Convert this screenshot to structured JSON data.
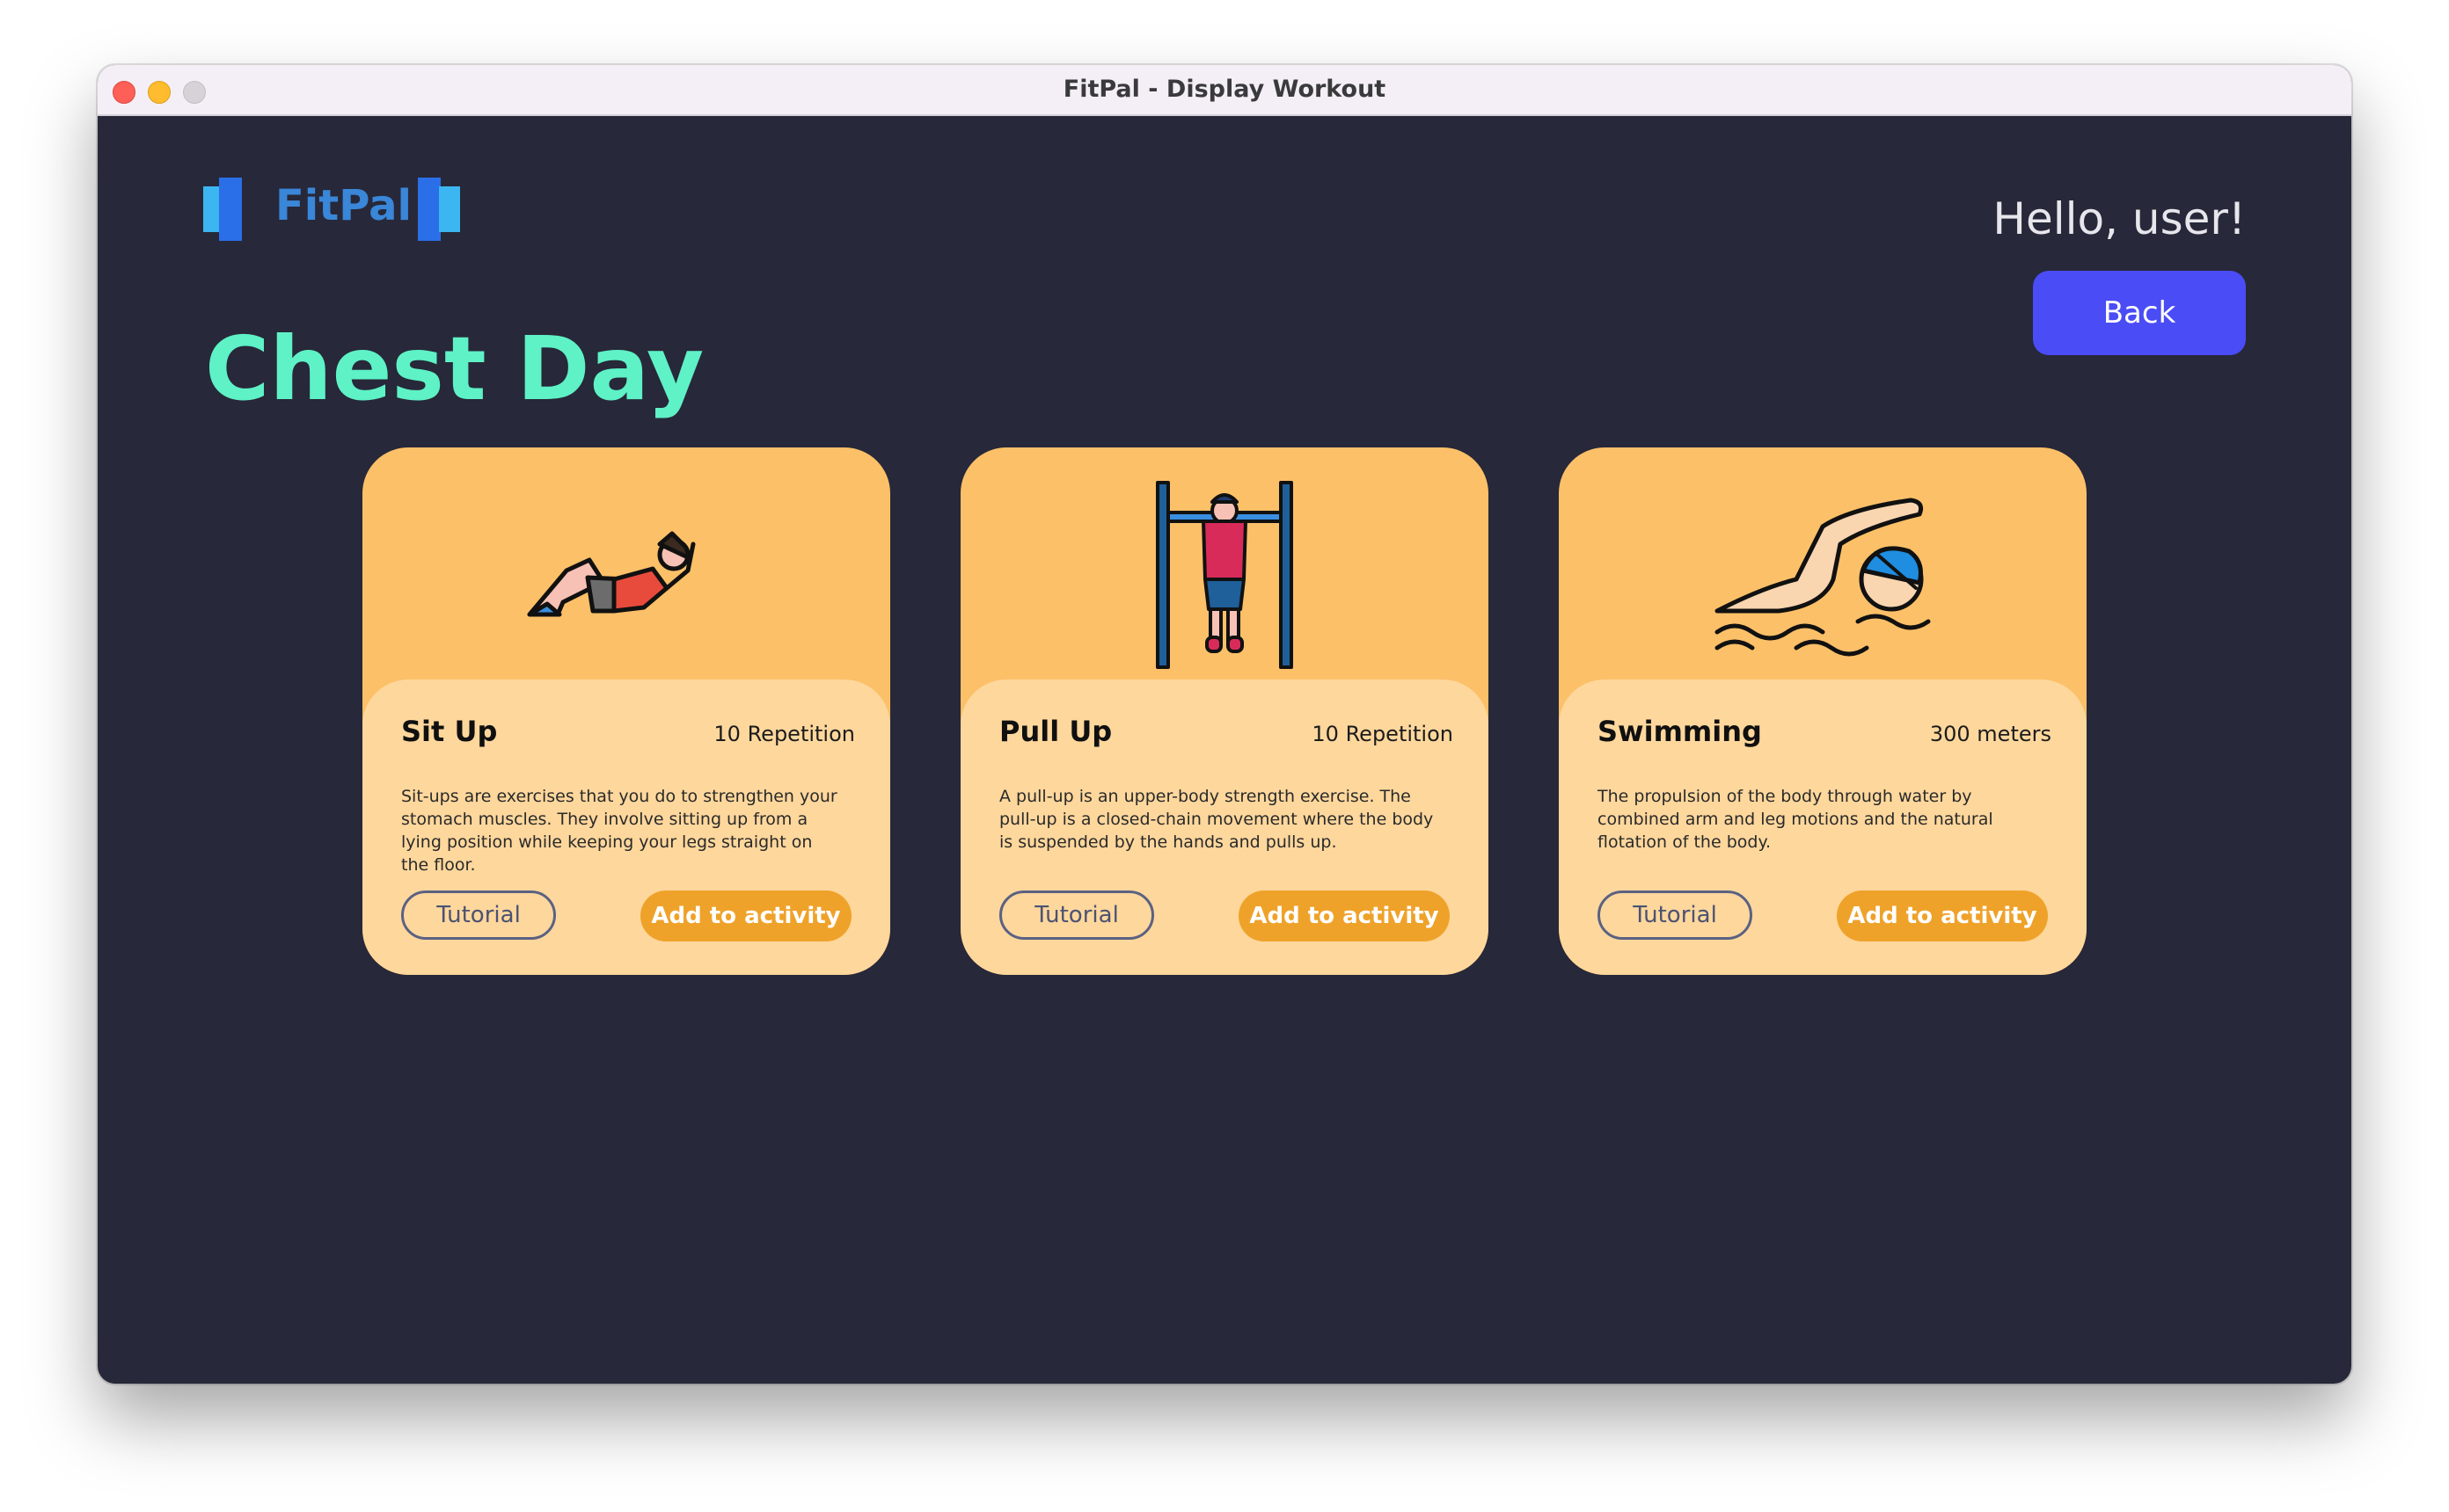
{
  "window": {
    "title": "FitPal - Display Workout"
  },
  "header": {
    "logo_text": "FitPal",
    "greeting": "Hello, user!",
    "back_label": "Back"
  },
  "page": {
    "title": "Chest Day"
  },
  "colors": {
    "background": "#272839",
    "title_accent": "#5ef2c6",
    "back_button": "#4a4cf5",
    "card_top": "#fcc068",
    "card_body": "#fed79c",
    "add_button": "#efa22a"
  },
  "exercises": [
    {
      "name": "Sit Up",
      "amount": "10 Repetition",
      "description": "Sit-ups are exercises that you do to strengthen your stomach muscles. They involve sitting up from a lying position while keeping your legs straight on the floor.",
      "icon": "sit-up-figure-icon",
      "tutorial_label": "Tutorial",
      "add_label": "Add to activity"
    },
    {
      "name": "Pull Up",
      "amount": "10 Repetition",
      "description": "A pull-up is an upper-body strength exercise. The pull-up is a closed-chain movement where the body is suspended by the hands and pulls up.",
      "icon": "pull-up-figure-icon",
      "tutorial_label": "Tutorial",
      "add_label": "Add to activity"
    },
    {
      "name": "Swimming",
      "amount": "300 meters",
      "description": "The propulsion of the body through water by combined arm and leg motions and the natural flotation of the body.",
      "icon": "swimmer-figure-icon",
      "tutorial_label": "Tutorial",
      "add_label": "Add to activity"
    }
  ]
}
